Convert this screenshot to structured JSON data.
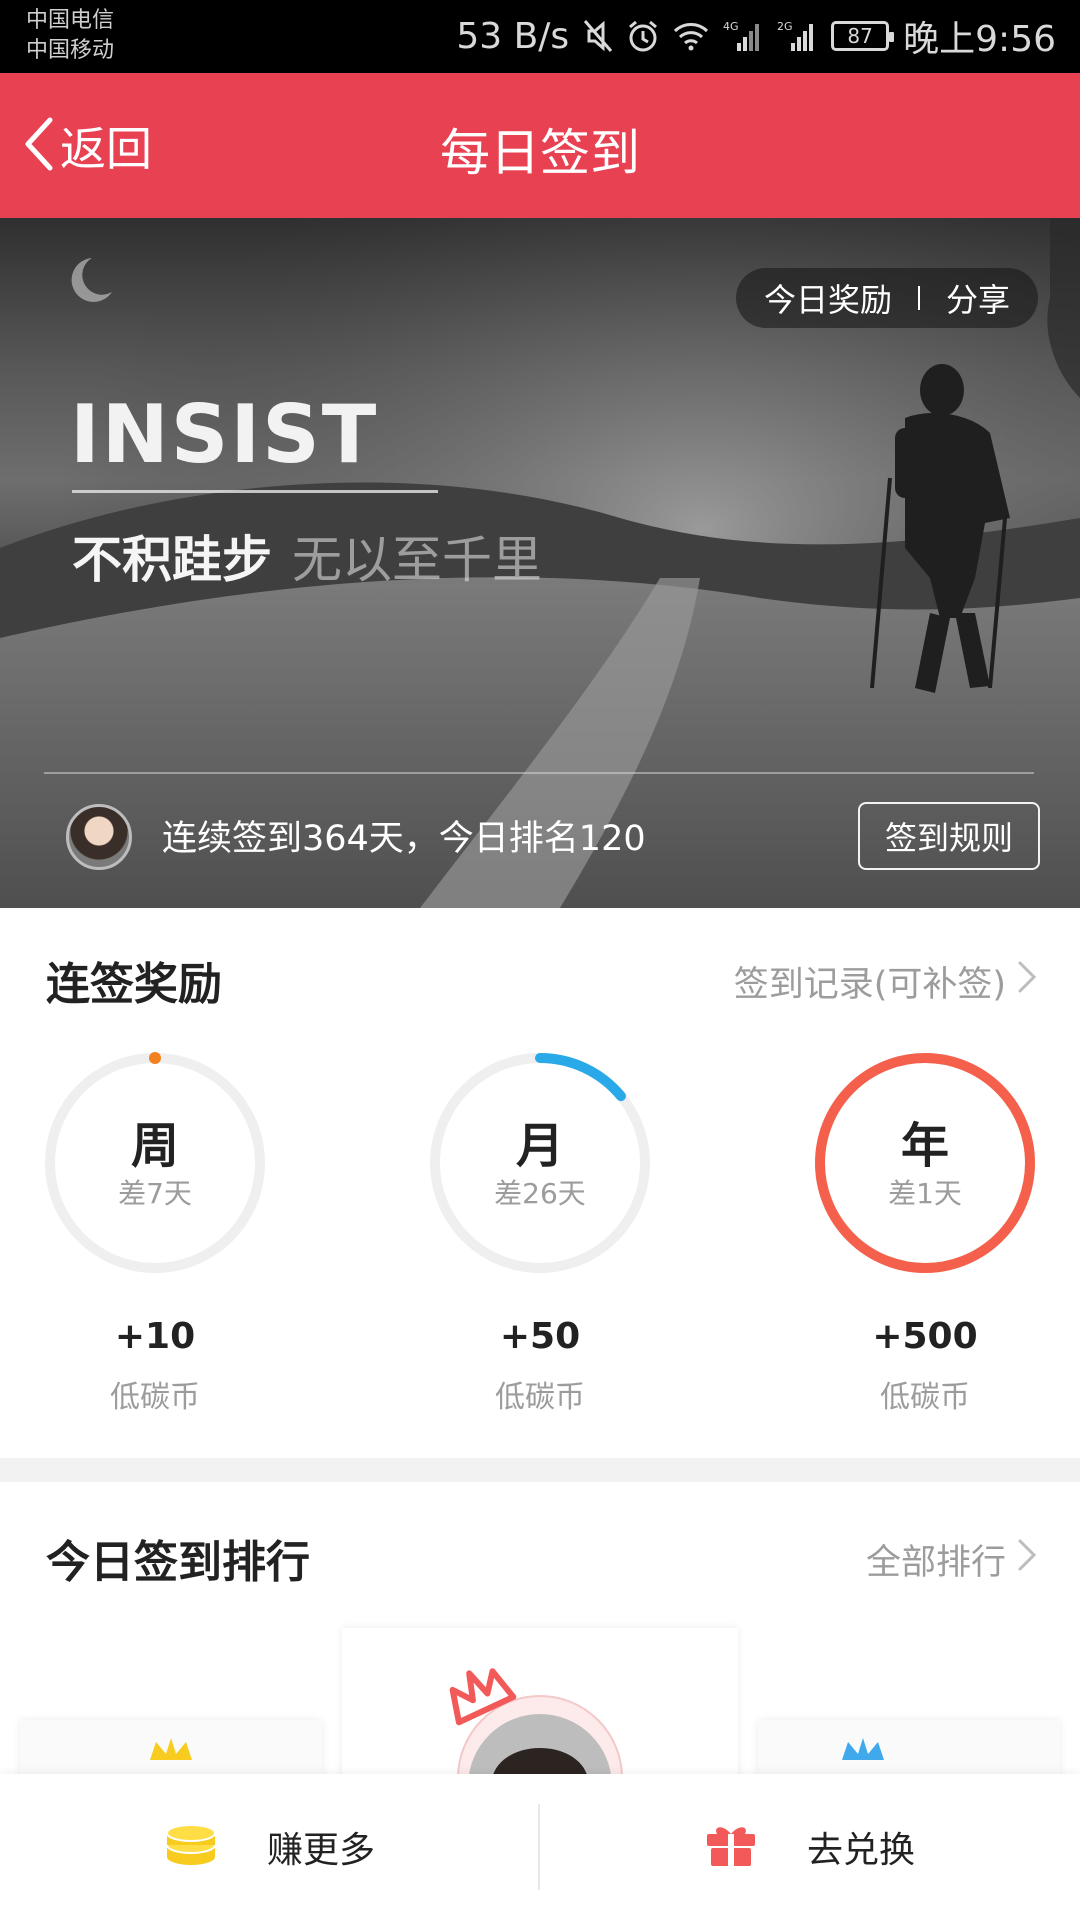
{
  "status_bar": {
    "carrier_1": "中国电信",
    "carrier_2": "中国移动",
    "speed": "53 B/s",
    "net_4g": "4G",
    "net_2g": "2G",
    "battery": "87",
    "time": "晚上9:56",
    "icons": [
      "mute-icon",
      "alarm-icon",
      "wifi-icon",
      "signal-4g-icon",
      "signal-2g-icon",
      "battery-icon"
    ]
  },
  "nav": {
    "back_label": "返回",
    "title": "每日签到"
  },
  "banner": {
    "today_reward": "今日奖励",
    "share": "分享",
    "headline": "INSIST",
    "slogan_bold": "不积跬步",
    "slogan_light": "无以至千里",
    "streak_text": "连续签到364天，今日排名120",
    "rules_button": "签到规则"
  },
  "streak_rewards": {
    "title": "连签奖励",
    "record_link": "签到记录(可补签)",
    "items": [
      {
        "period": "周",
        "remaining": "差7天",
        "amount": "+10",
        "unit": "低碳币",
        "progress": 0.0,
        "color": "#f2821f"
      },
      {
        "period": "月",
        "remaining": "差26天",
        "amount": "+50",
        "unit": "低碳币",
        "progress": 0.14,
        "color": "#29a9e8"
      },
      {
        "period": "年",
        "remaining": "差1天",
        "amount": "+500",
        "unit": "低碳币",
        "progress": 1.0,
        "color": "#f4604b"
      }
    ]
  },
  "ranking": {
    "title": "今日签到排行",
    "all_link": "全部排行"
  },
  "bottom_bar": {
    "earn_more": "赚更多",
    "redeem": "去兑换"
  },
  "colors": {
    "brand_red": "#e84152",
    "coin_yellow": "#f7cc1e",
    "gift_red": "#f25a5a"
  }
}
